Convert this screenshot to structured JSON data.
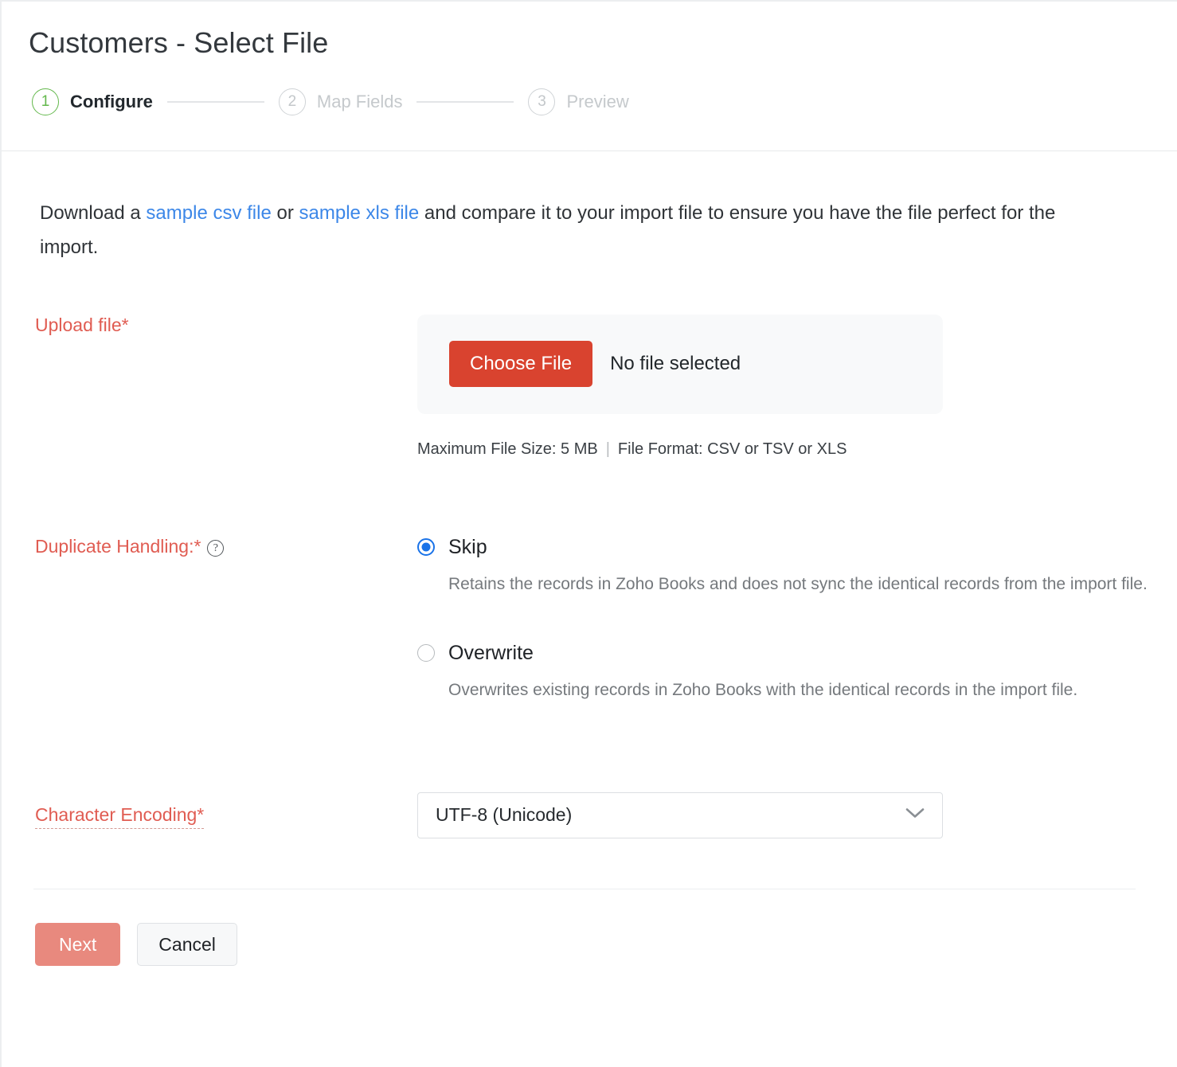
{
  "header": {
    "title": "Customers - Select File"
  },
  "stepper": {
    "steps": [
      {
        "number": "1",
        "label": "Configure",
        "state": "active"
      },
      {
        "number": "2",
        "label": "Map Fields",
        "state": "inactive"
      },
      {
        "number": "3",
        "label": "Preview",
        "state": "inactive"
      }
    ]
  },
  "intro": {
    "text_before": "Download a ",
    "link_csv": "sample csv file",
    "text_between": " or ",
    "link_xls": "sample xls file",
    "text_after": " and compare it to your import file to ensure you have the file perfect for the import."
  },
  "upload": {
    "label": "Upload file*",
    "choose_button": "Choose File",
    "file_status": "No file selected",
    "hint_size": "Maximum File Size: 5 MB",
    "hint_separator": "|",
    "hint_format": "File Format: CSV or TSV or XLS"
  },
  "duplicate_handling": {
    "label": "Duplicate Handling:*",
    "help_icon": "question-mark-icon",
    "options": [
      {
        "value": "skip",
        "label": "Skip",
        "description": "Retains the records in Zoho Books and does not sync the identical records from the import file.",
        "selected": true
      },
      {
        "value": "overwrite",
        "label": "Overwrite",
        "description": "Overwrites existing records in Zoho Books with the identical records in the import file.",
        "selected": false
      }
    ]
  },
  "character_encoding": {
    "label": "Character Encoding*",
    "selected_value": "UTF-8 (Unicode)",
    "chevron_icon": "chevron-down-icon"
  },
  "footer": {
    "next_label": "Next",
    "cancel_label": "Cancel"
  },
  "colors": {
    "accent_red": "#d9432f",
    "next_disabled": "#e8897e",
    "required_label": "#e05c52",
    "link_blue": "#3c87e8",
    "radio_blue": "#1a73e8",
    "step_active_green": "#63b84c",
    "step_inactive_gray": "#c5c9cc",
    "upload_box_bg": "#f8f9fa"
  }
}
